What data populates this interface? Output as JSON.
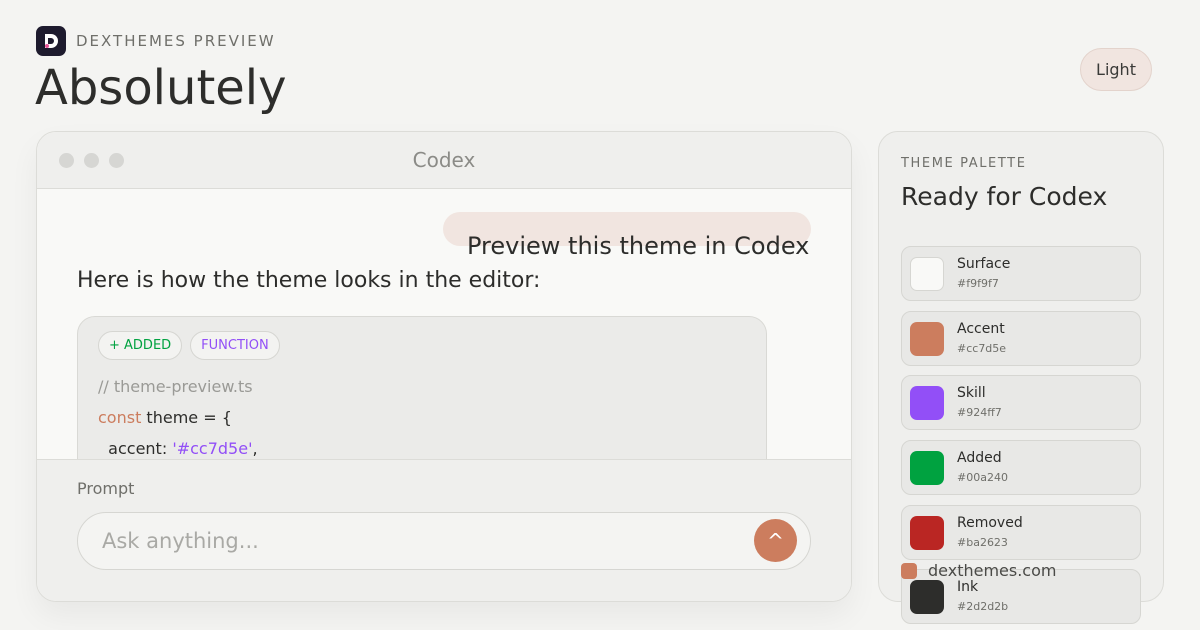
{
  "brand": {
    "eyebrow": "DEXTHEMES PREVIEW",
    "logo_icon": "dexthemes-logo-icon"
  },
  "headline": "Absolutely",
  "mode_toggle": {
    "label": "Light"
  },
  "window": {
    "title": "Codex",
    "user_message": "Preview this theme in Codex",
    "assistant_message": "Here is how the theme looks in the editor:",
    "tags": {
      "added": "+ ADDED",
      "function": "FUNCTION"
    },
    "code": {
      "comment": "// theme-preview.ts",
      "kw": "const",
      "decl_rest": " theme = {",
      "key": "  accent: ",
      "value": "'#cc7d5e'",
      "trail": ","
    },
    "prompt": {
      "label": "Prompt",
      "placeholder": "Ask anything...",
      "send_icon": "^"
    }
  },
  "palette": {
    "eyebrow": "THEME PALETTE",
    "title": "Ready for Codex",
    "swatches": [
      {
        "name": "Surface",
        "hex": "#f9f9f7"
      },
      {
        "name": "Accent",
        "hex": "#cc7d5e"
      },
      {
        "name": "Skill",
        "hex": "#924ff7"
      },
      {
        "name": "Added",
        "hex": "#00a240"
      },
      {
        "name": "Removed",
        "hex": "#ba2623"
      },
      {
        "name": "Ink",
        "hex": "#2d2d2b"
      }
    ]
  },
  "footer": {
    "site": "dexthemes.com"
  },
  "colors": {
    "accent": "#cc7d5e",
    "skill": "#924ff7",
    "added": "#00a240",
    "removed": "#ba2623",
    "ink": "#2d2d2b",
    "surface": "#f9f9f7"
  }
}
